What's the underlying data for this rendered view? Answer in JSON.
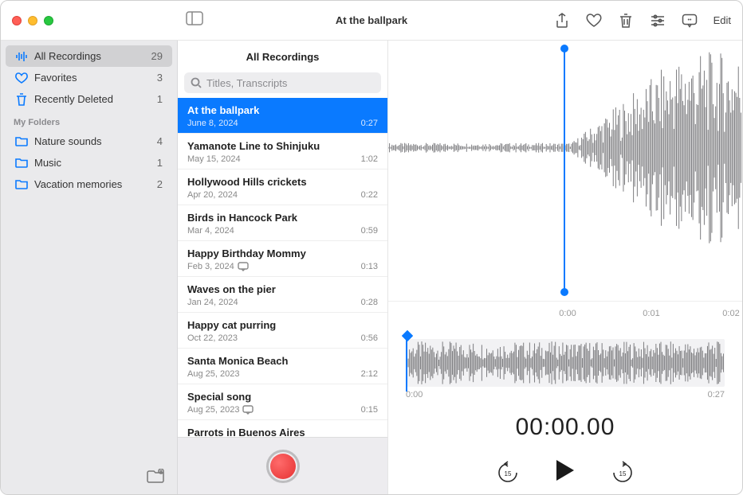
{
  "toolbar": {
    "title": "At the ballpark",
    "edit_label": "Edit"
  },
  "sidebar": {
    "smart": [
      {
        "label": "All Recordings",
        "count": "29",
        "icon": "waveform",
        "selected": true
      },
      {
        "label": "Favorites",
        "count": "3",
        "icon": "heart"
      },
      {
        "label": "Recently Deleted",
        "count": "1",
        "icon": "trash"
      }
    ],
    "folders_header": "My Folders",
    "folders": [
      {
        "label": "Nature sounds",
        "count": "4"
      },
      {
        "label": "Music",
        "count": "1"
      },
      {
        "label": "Vacation memories",
        "count": "2"
      }
    ]
  },
  "middle": {
    "title": "All Recordings",
    "search_placeholder": "Titles, Transcripts"
  },
  "recordings": [
    {
      "title": "At the ballpark",
      "date": "June 8, 2024",
      "duration": "0:27",
      "selected": true
    },
    {
      "title": "Yamanote Line to Shinjuku",
      "date": "May 15, 2024",
      "duration": "1:02"
    },
    {
      "title": "Hollywood Hills crickets",
      "date": "Apr 20, 2024",
      "duration": "0:22"
    },
    {
      "title": "Birds in Hancock Park",
      "date": "Mar 4, 2024",
      "duration": "0:59"
    },
    {
      "title": "Happy Birthday Mommy",
      "date": "Feb 3, 2024",
      "duration": "0:13",
      "has_transcript": true
    },
    {
      "title": "Waves on the pier",
      "date": "Jan 24, 2024",
      "duration": "0:28"
    },
    {
      "title": "Happy cat purring",
      "date": "Oct 22, 2023",
      "duration": "0:56"
    },
    {
      "title": "Santa Monica Beach",
      "date": "Aug 25, 2023",
      "duration": "2:12"
    },
    {
      "title": "Special song",
      "date": "Aug 25, 2023",
      "duration": "0:15",
      "has_transcript": true
    },
    {
      "title": "Parrots in Buenos Aires",
      "date": "",
      "duration": ""
    }
  ],
  "detail": {
    "ruler": [
      "0:00",
      "0:01",
      "0:02"
    ],
    "overview_start": "0:00",
    "overview_end": "0:27",
    "current_time": "00:00.00",
    "skip_seconds": "15"
  }
}
